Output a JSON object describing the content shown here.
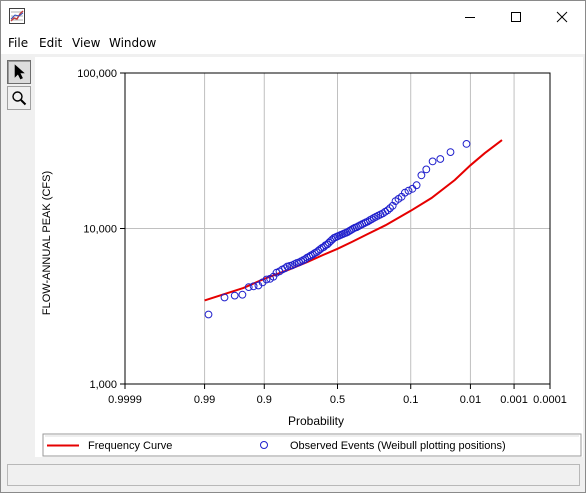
{
  "window": {
    "title": ""
  },
  "menu": [
    "File",
    "Edit",
    "View",
    "Window"
  ],
  "colors": {
    "curve": "#e60000",
    "points": "#1f1fcc",
    "grid": "#c0c0c0"
  },
  "icons": {
    "app": "graph-icon",
    "pointer": "arrow-pointer-icon",
    "zoom": "magnifier-icon"
  },
  "legend": {
    "curve_label": "Frequency Curve",
    "points_label": "Observed Events (Weibull plotting positions)"
  },
  "chart_data": {
    "type": "line",
    "xlabel": "Probability",
    "ylabel": "FLOW-ANNUAL PEAK (CFS)",
    "y_scale": "log",
    "ylim": [
      1000,
      100000
    ],
    "x_scale": "normal-probability",
    "xlim": [
      0.9999,
      0.0001
    ],
    "x_ticks": [
      {
        "p": 0.9999,
        "label": "0.9999"
      },
      {
        "p": 0.99,
        "label": "0.99"
      },
      {
        "p": 0.9,
        "label": "0.9"
      },
      {
        "p": 0.5,
        "label": "0.5"
      },
      {
        "p": 0.1,
        "label": "0.1"
      },
      {
        "p": 0.01,
        "label": "0.01"
      },
      {
        "p": 0.001,
        "label": "0.001"
      },
      {
        "p": 0.0001,
        "label": "0.0001"
      }
    ],
    "y_ticks": [
      {
        "v": 1000,
        "label": "1,000"
      },
      {
        "v": 10000,
        "label": "10,000"
      },
      {
        "v": 100000,
        "label": "100,000"
      }
    ],
    "grid": true,
    "legend_position": "bottom",
    "series": [
      {
        "name": "Frequency Curve",
        "type": "line",
        "p": [
          0.99,
          0.95,
          0.9,
          0.8,
          0.7,
          0.6,
          0.5,
          0.4,
          0.3,
          0.2,
          0.1,
          0.05,
          0.02,
          0.01,
          0.005,
          0.002
        ],
        "y": [
          3450,
          4150,
          4750,
          5450,
          6100,
          6750,
          7400,
          8200,
          9200,
          10500,
          13000,
          15700,
          20500,
          25500,
          30500,
          37000
        ]
      },
      {
        "name": "Observed Events (Weibull plotting positions)",
        "type": "scatter",
        "p": [
          0.988,
          0.976,
          0.964,
          0.952,
          0.94,
          0.929,
          0.917,
          0.905,
          0.893,
          0.881,
          0.869,
          0.857,
          0.845,
          0.833,
          0.821,
          0.81,
          0.798,
          0.786,
          0.774,
          0.762,
          0.75,
          0.738,
          0.726,
          0.714,
          0.702,
          0.69,
          0.679,
          0.667,
          0.655,
          0.643,
          0.631,
          0.619,
          0.607,
          0.595,
          0.583,
          0.571,
          0.56,
          0.548,
          0.536,
          0.524,
          0.512,
          0.5,
          0.488,
          0.476,
          0.464,
          0.452,
          0.44,
          0.429,
          0.417,
          0.405,
          0.393,
          0.381,
          0.369,
          0.357,
          0.345,
          0.333,
          0.321,
          0.31,
          0.298,
          0.286,
          0.274,
          0.262,
          0.25,
          0.238,
          0.226,
          0.214,
          0.202,
          0.19,
          0.179,
          0.167,
          0.155,
          0.143,
          0.131,
          0.119,
          0.107,
          0.095,
          0.083,
          0.071,
          0.06,
          0.048,
          0.036,
          0.024,
          0.012
        ],
        "y": [
          2800,
          3600,
          3700,
          3750,
          4200,
          4250,
          4300,
          4500,
          4700,
          4750,
          4900,
          5200,
          5300,
          5450,
          5550,
          5700,
          5750,
          5800,
          5900,
          6000,
          6050,
          6150,
          6250,
          6350,
          6500,
          6600,
          6700,
          6800,
          6950,
          7050,
          7200,
          7350,
          7500,
          7600,
          7800,
          7900,
          8100,
          8300,
          8500,
          8700,
          8800,
          8900,
          9000,
          9100,
          9200,
          9300,
          9400,
          9500,
          9650,
          9800,
          9950,
          10100,
          10200,
          10350,
          10500,
          10650,
          10800,
          10950,
          11100,
          11300,
          11500,
          11700,
          11900,
          12100,
          12300,
          12500,
          12800,
          13100,
          13500,
          14000,
          15000,
          15500,
          16000,
          17000,
          17500,
          18000,
          19000,
          22000,
          24000,
          27000,
          28000,
          31000,
          35000
        ]
      }
    ]
  }
}
